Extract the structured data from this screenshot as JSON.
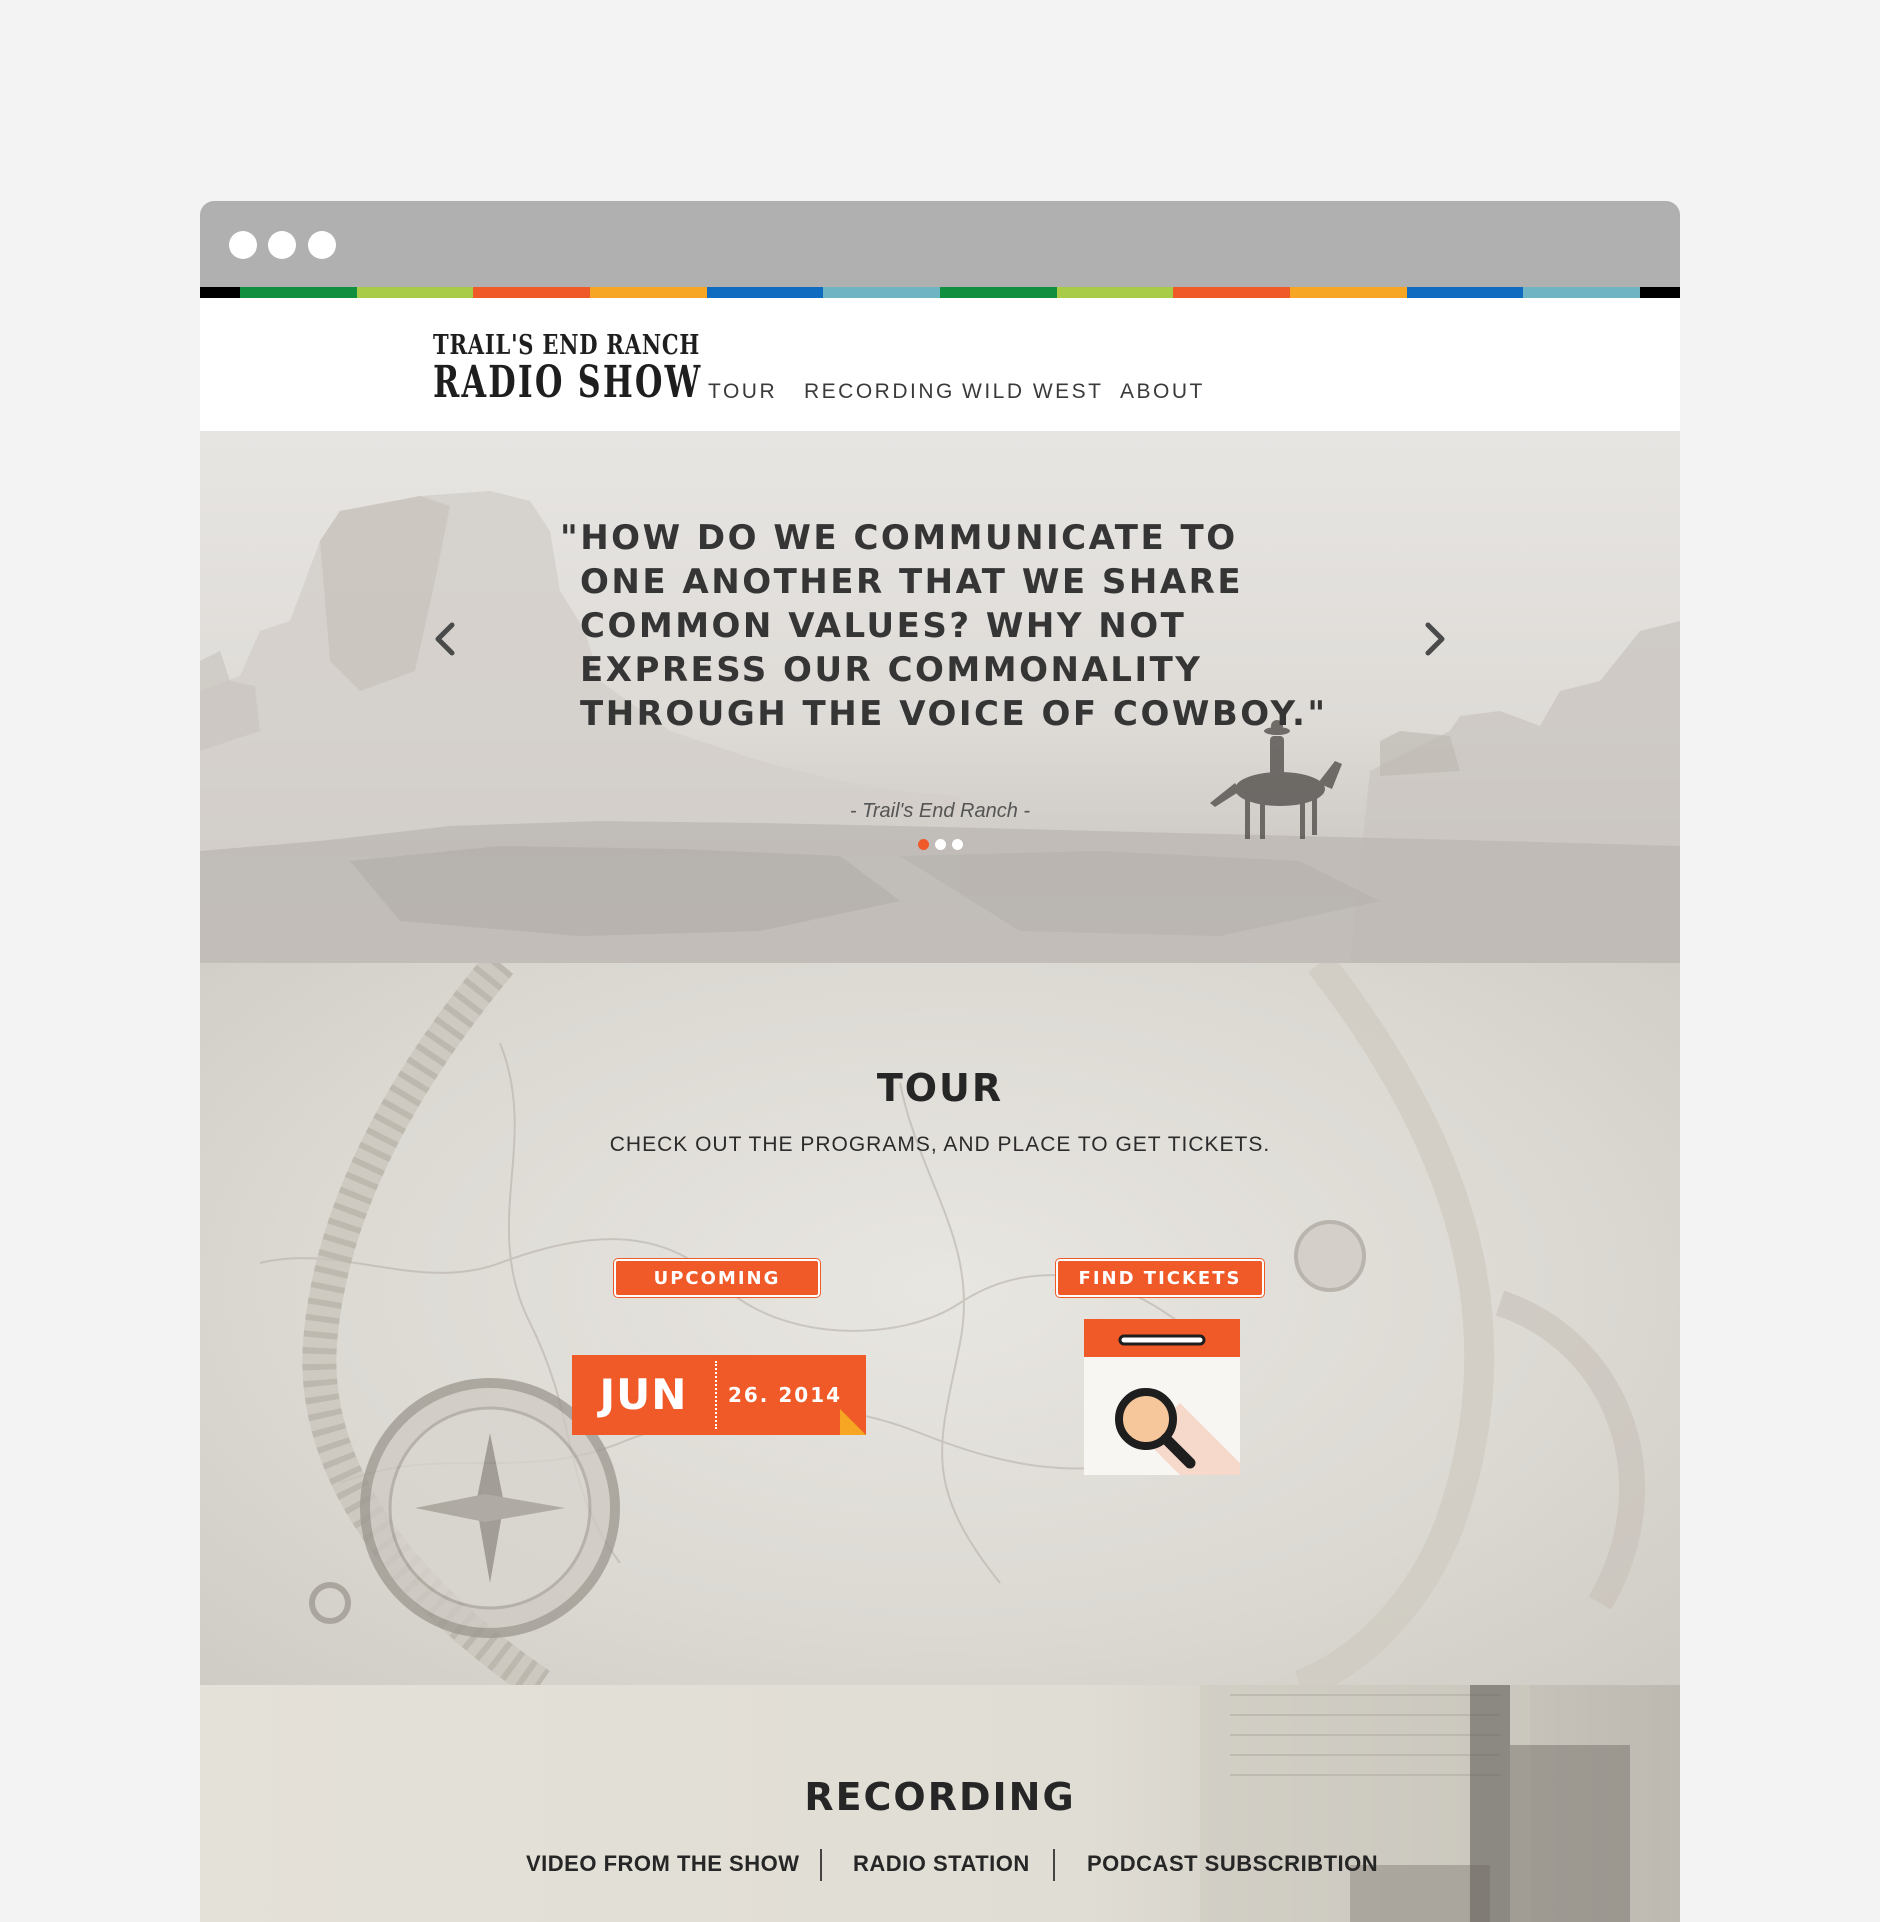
{
  "stripe_colors": [
    "#000000",
    "#108f3e",
    "#a8cc48",
    "#f05a28",
    "#f6a623",
    "#0f6bbf",
    "#6fb4c3",
    "#108f3e",
    "#a8cc48",
    "#f05a28",
    "#f6a623",
    "#0f6bbf",
    "#6fb4c3",
    "#000000"
  ],
  "brand": {
    "line1": "TRAIL'S END RANCH",
    "line2": "RADIO SHOW",
    "accent": "#f05a28"
  },
  "nav": {
    "items": [
      {
        "label": "TOUR"
      },
      {
        "label": "RECORDING"
      },
      {
        "label": "WILD WEST"
      },
      {
        "label": "ABOUT"
      }
    ]
  },
  "hero": {
    "quote": "\"HOW DO WE COMMUNICATE TO ONE ANOTHER THAT WE SHARE COMMON VALUES? WHY NOT EXPRESS OUR COMMONALITY THROUGH THE VOICE OF COWBOY.\"",
    "attribution": "- Trail's End Ranch -",
    "prev_icon": "chevron-left-icon",
    "next_icon": "chevron-right-icon",
    "slides_total": 3,
    "slide_active": 1
  },
  "tour": {
    "title": "TOUR",
    "subtitle": "CHECK OUT THE PROGRAMS, AND PLACE TO GET TICKETS.",
    "upcoming_label": "UPCOMING",
    "date_month": "JUN",
    "date_day": "26. 2014",
    "find_tickets_label": "FIND TICKETS",
    "ticket_icon": "calendar-search-icon"
  },
  "recording": {
    "title": "RECORDING",
    "links": [
      {
        "label": "VIDEO FROM THE SHOW"
      },
      {
        "label": "RADIO STATION"
      },
      {
        "label": "PODCAST SUBSCRIBTION"
      }
    ]
  }
}
